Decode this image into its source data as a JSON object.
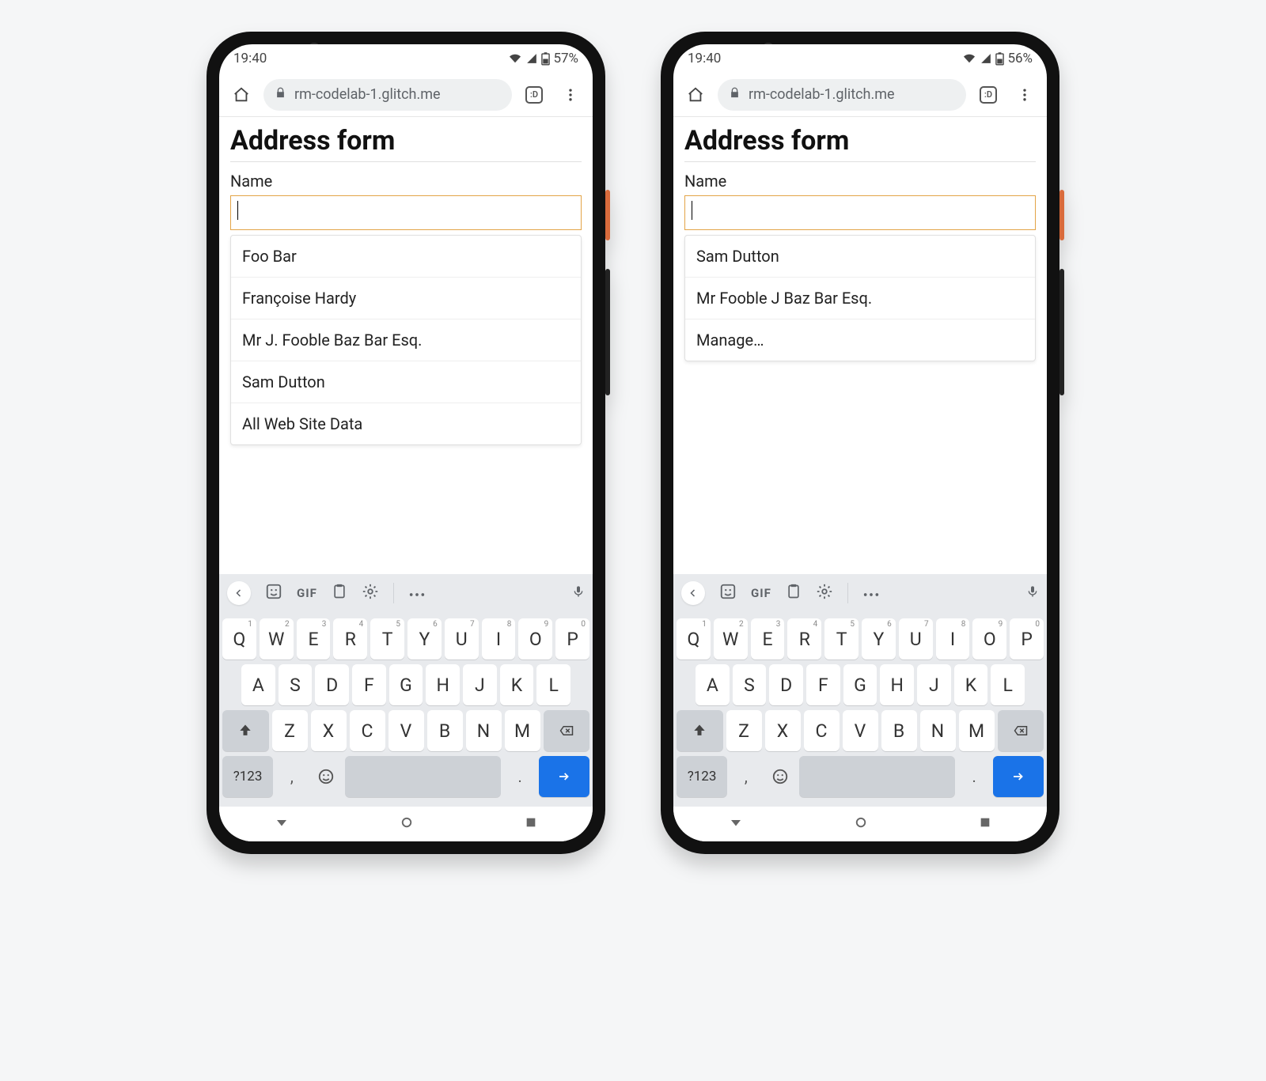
{
  "phones": [
    {
      "status": {
        "time": "19:40",
        "battery": "57%"
      },
      "browser": {
        "url": "rm-codelab-1.glitch.me",
        "tab_badge": ":D"
      },
      "page": {
        "title": "Address form",
        "name_label": "Name",
        "name_value": "",
        "suggestions": [
          "Foo Bar",
          "Françoise Hardy",
          "Mr J. Fooble Baz Bar Esq.",
          "Sam Dutton",
          "All Web Site Data"
        ]
      }
    },
    {
      "status": {
        "time": "19:40",
        "battery": "56%"
      },
      "browser": {
        "url": "rm-codelab-1.glitch.me",
        "tab_badge": ":D"
      },
      "page": {
        "title": "Address form",
        "name_label": "Name",
        "name_value": "",
        "suggestions": [
          "Sam Dutton",
          "Mr Fooble J Baz Bar Esq.",
          "Manage…"
        ]
      }
    }
  ],
  "keyboard": {
    "toolbar": {
      "gif_label": "GIF"
    },
    "row1": [
      "Q",
      "W",
      "E",
      "R",
      "T",
      "Y",
      "U",
      "I",
      "O",
      "P"
    ],
    "row1_sup": [
      "1",
      "2",
      "3",
      "4",
      "5",
      "6",
      "7",
      "8",
      "9",
      "0"
    ],
    "row2": [
      "A",
      "S",
      "D",
      "F",
      "G",
      "H",
      "J",
      "K",
      "L"
    ],
    "row3": [
      "Z",
      "X",
      "C",
      "V",
      "B",
      "N",
      "M"
    ],
    "sym_label": "?123",
    "comma": ",",
    "period": "."
  }
}
